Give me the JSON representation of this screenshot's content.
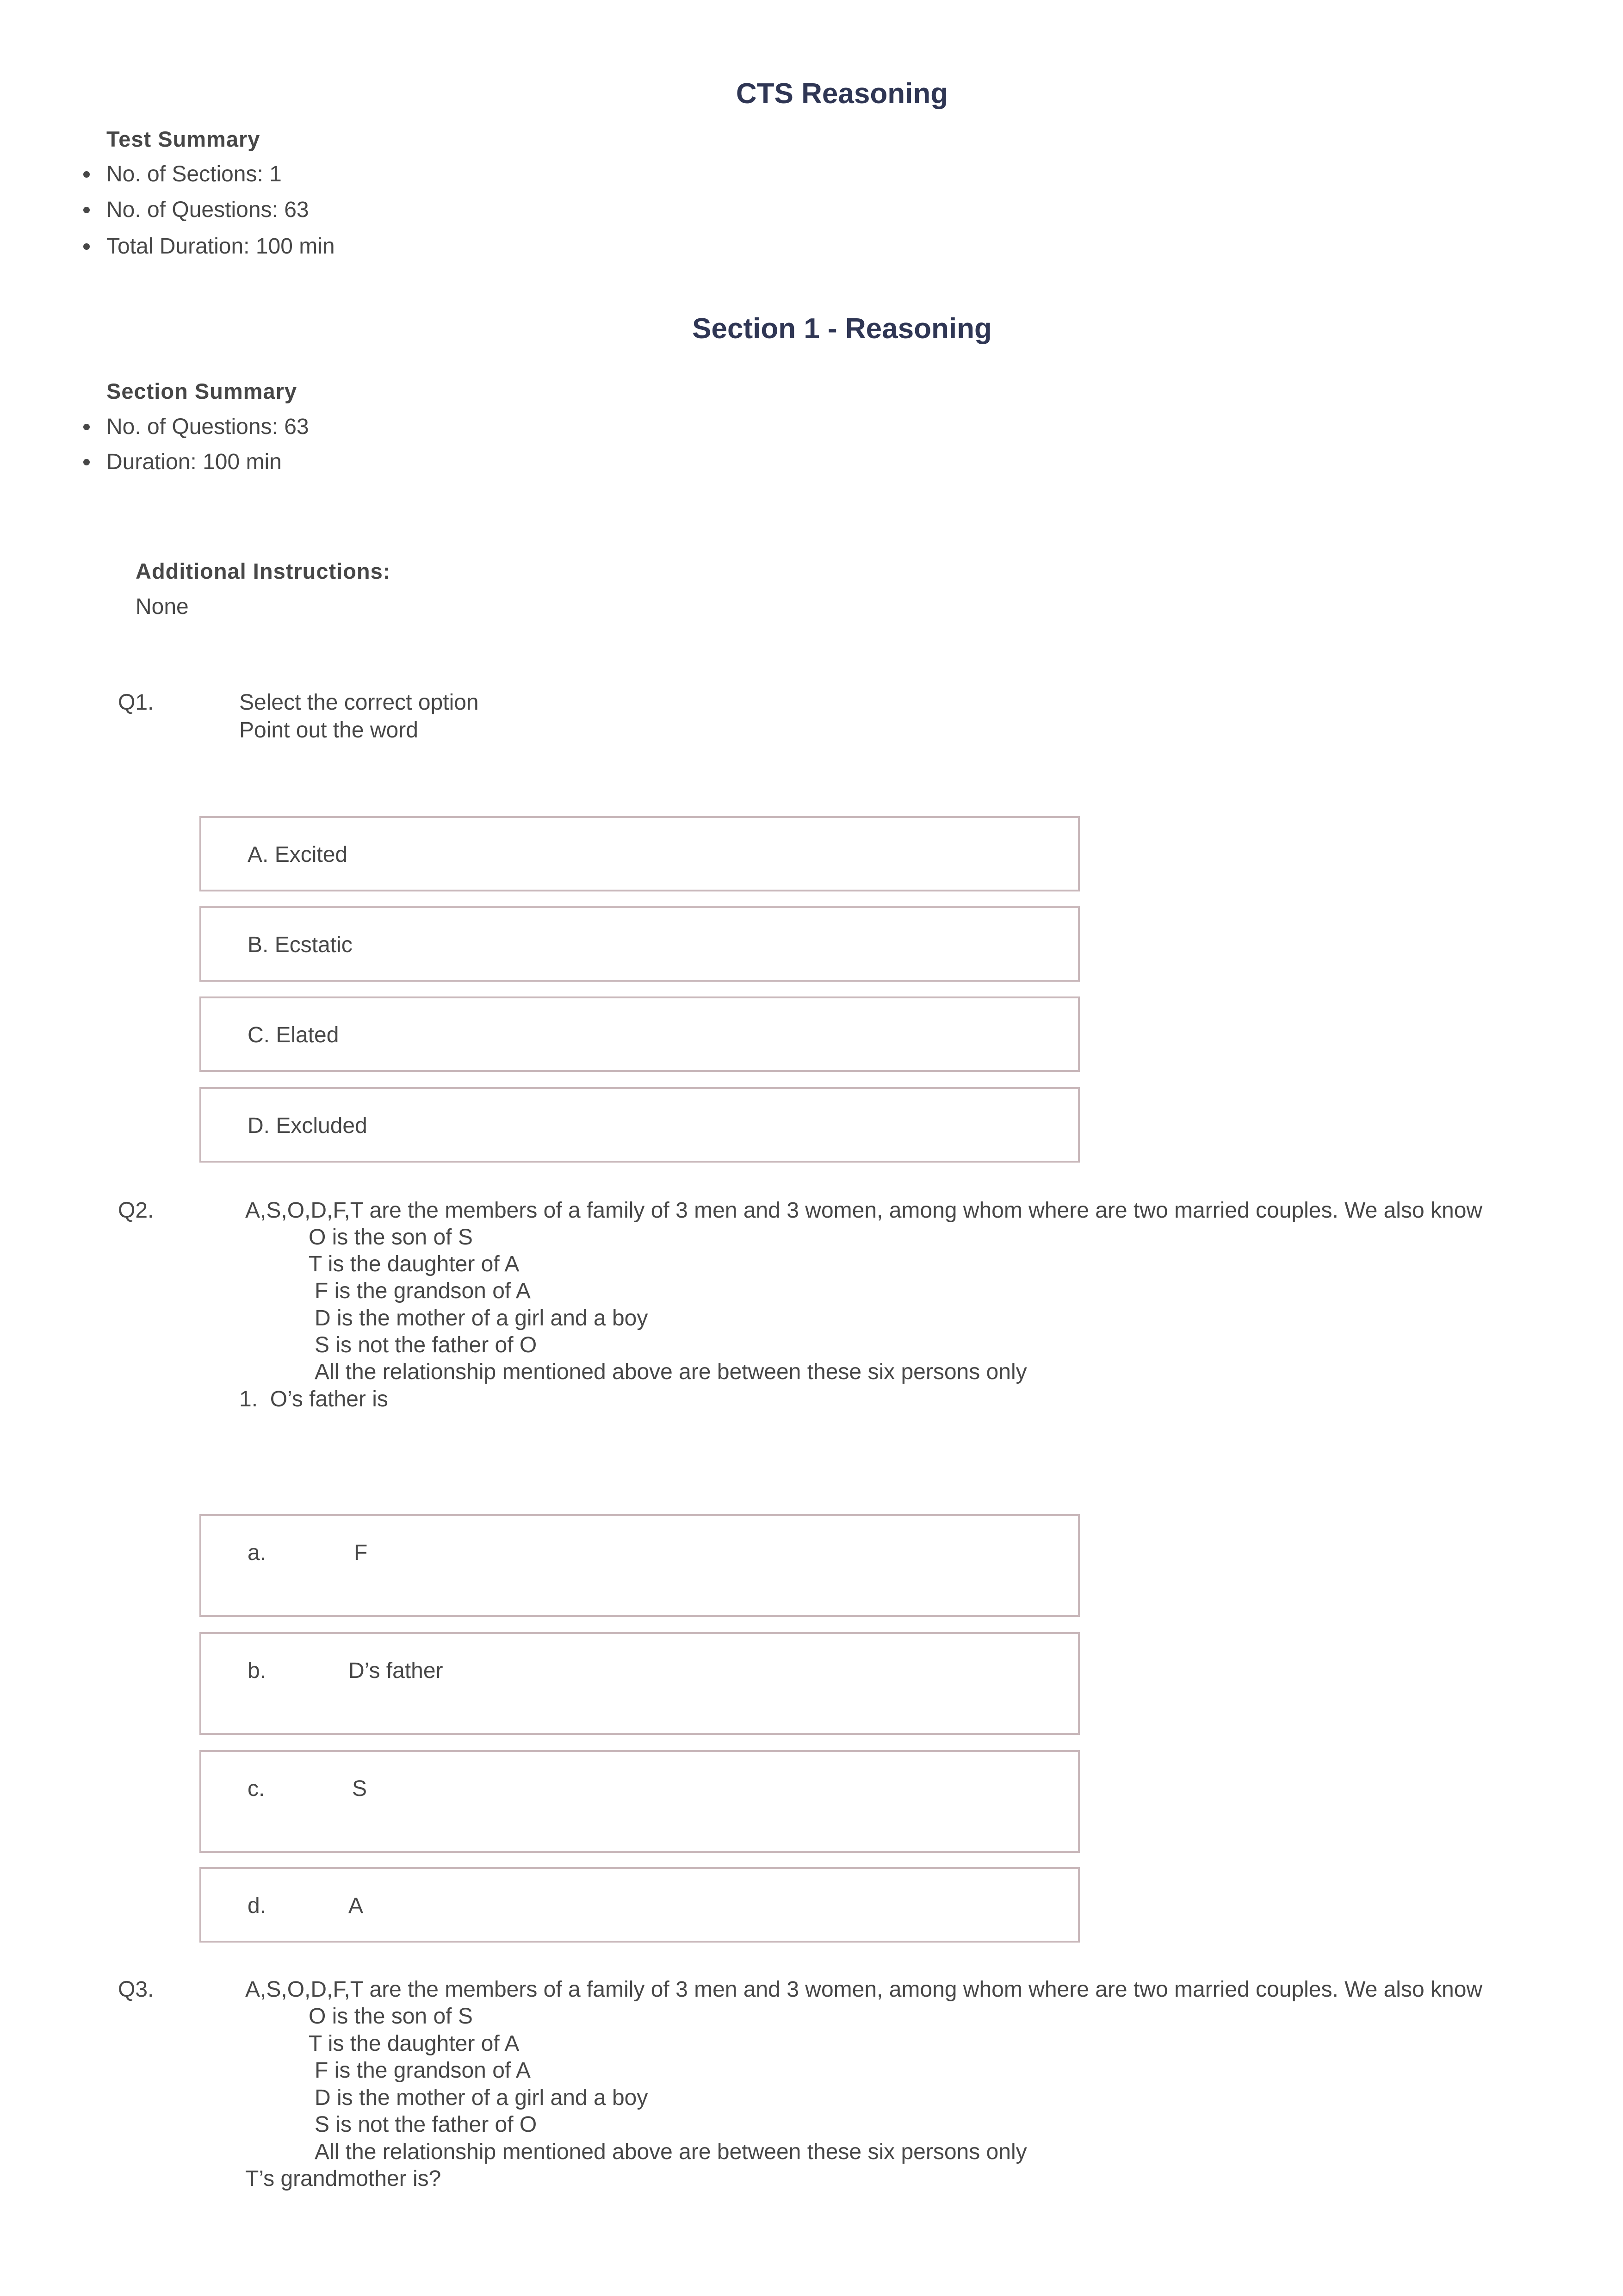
{
  "document": {
    "title": "CTS Reasoning",
    "test_summary": {
      "heading": "Test Summary",
      "items": [
        "No. of Sections: 1",
        "No. of Questions: 63",
        "Total Duration: 100 min"
      ]
    },
    "section": {
      "title": "Section 1 - Reasoning",
      "summary_heading": "Section Summary",
      "summary_items": [
        "No. of Questions: 63",
        "Duration: 100 min"
      ],
      "instructions_heading": "Additional Instructions:",
      "instructions_text": "None"
    },
    "colors": {
      "heading": "#2f3654",
      "body_text": "#474747",
      "option_border": "#c9b8bb"
    }
  },
  "questions": [
    {
      "number": "Q1.",
      "lines": [
        "Select the correct option",
        "Point out the word"
      ],
      "options": [
        {
          "letter": "A.",
          "text": "Excited"
        },
        {
          "letter": "B.",
          "text": "Ecstatic"
        },
        {
          "letter": "C.",
          "text": "Elated"
        },
        {
          "letter": "D.",
          "text": "Excluded"
        }
      ]
    },
    {
      "number": "Q2.",
      "intro": "A,S,O,D,F,T are the members of a family of 3 men and 3 women, among whom where are two married couples. We also know",
      "facts": [
        "O is the son of S",
        "T is the daughter of A",
        "F is the grandson of A",
        "D is the mother of a girl and a boy",
        "S is not the father of O",
        "All the relationship mentioned above are between these six persons only"
      ],
      "prompt": "1.  O’s father is",
      "options": [
        {
          "letter": "a.",
          "text": "F"
        },
        {
          "letter": "b.",
          "text": "D’s father"
        },
        {
          "letter": "c.",
          "text": "S"
        },
        {
          "letter": "d.",
          "text": "A"
        }
      ]
    },
    {
      "number": "Q3.",
      "intro": "A,S,O,D,F,T are the members of a family of 3 men and 3 women, among whom where are two married couples. We also know",
      "facts": [
        "O is the son of S",
        "T is the daughter of A",
        "F is the grandson of A",
        "D is the mother of a girl and a boy",
        "S is not the father of O",
        "All the relationship mentioned above are between these six persons only"
      ],
      "prompt": "T’s grandmother is?"
    }
  ]
}
